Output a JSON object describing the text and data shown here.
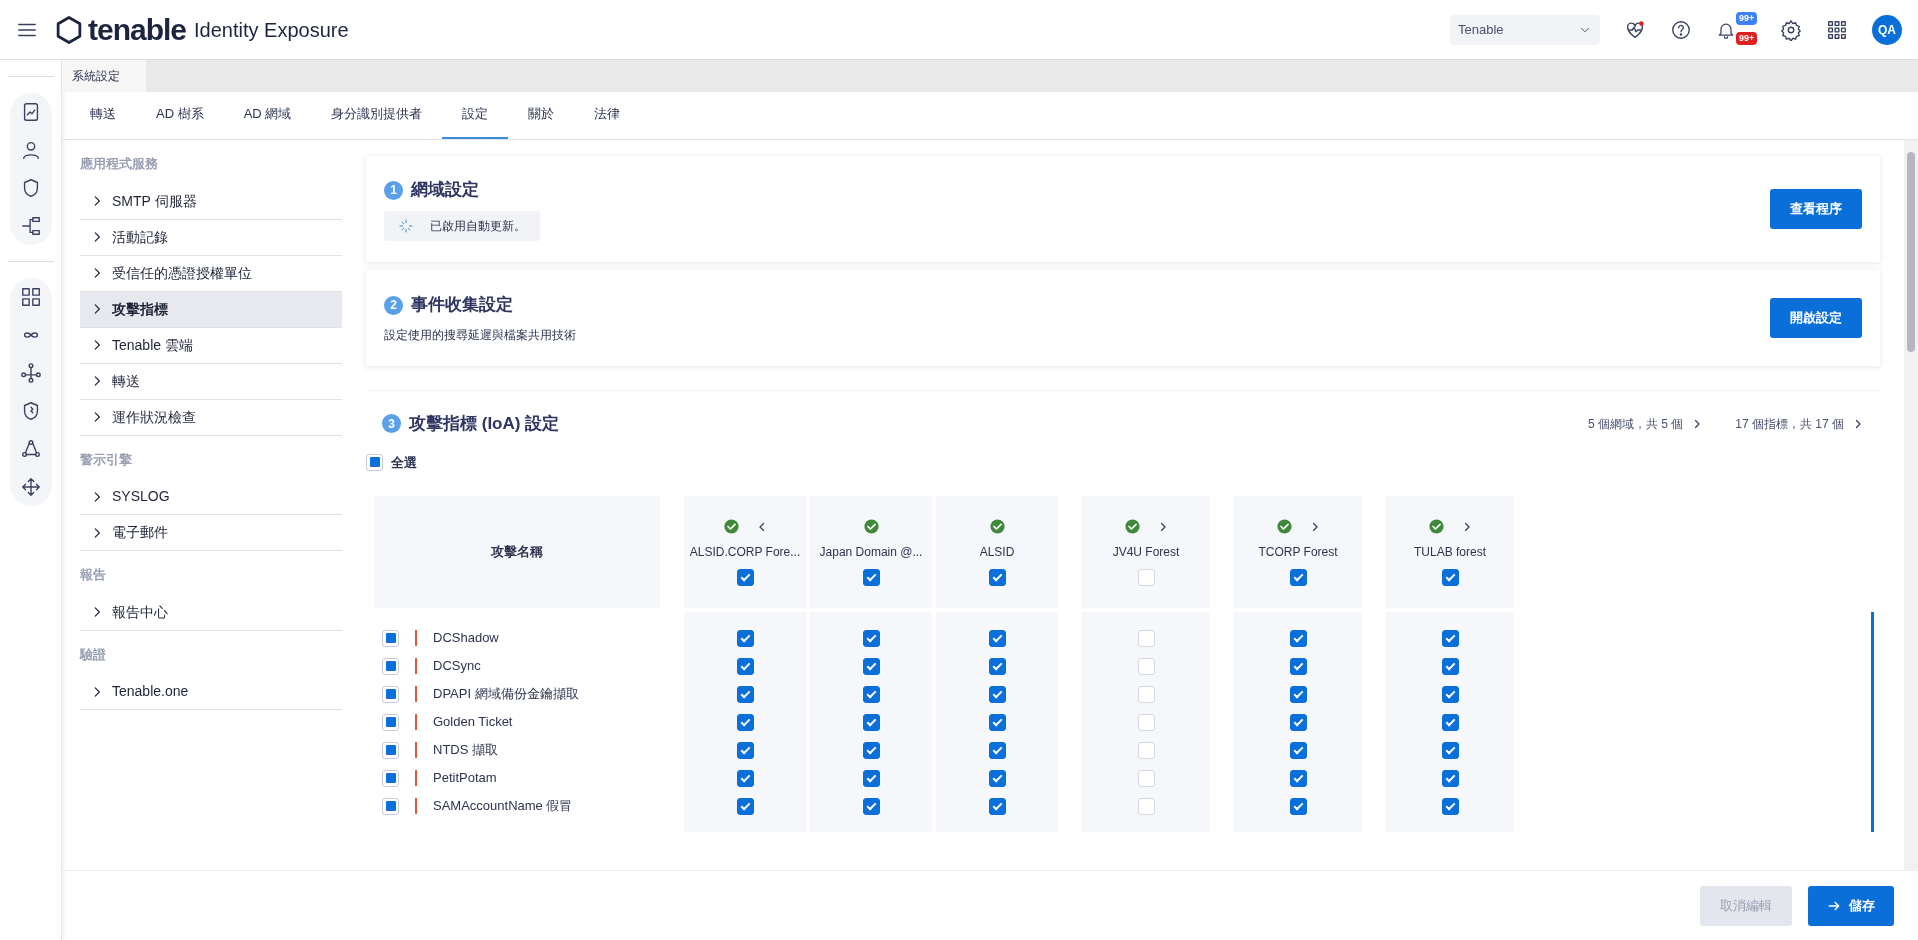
{
  "header": {
    "logo": "tenable",
    "product": "Identity Exposure",
    "tenant_select": {
      "value": "Tenable"
    },
    "notifications": [
      {
        "text": "99+",
        "color": "#3b82f6"
      },
      {
        "text": "99+",
        "color": "#e02020"
      }
    ],
    "avatar": "QA"
  },
  "page_tab": "系統設定",
  "tabs": [
    {
      "label": "轉送",
      "selected": false
    },
    {
      "label": "AD 樹系",
      "selected": false
    },
    {
      "label": "AD 網域",
      "selected": false
    },
    {
      "label": "身分識別提供者",
      "selected": false
    },
    {
      "label": "設定",
      "selected": true
    },
    {
      "label": "關於",
      "selected": false
    },
    {
      "label": "法律",
      "selected": false
    }
  ],
  "sidebar": [
    {
      "heading": "應用程式服務",
      "items": [
        {
          "label": "SMTP 伺服器",
          "selected": false
        },
        {
          "label": "活動記錄",
          "selected": false
        },
        {
          "label": "受信任的憑證授權單位",
          "selected": false
        },
        {
          "label": "攻擊指標",
          "selected": true
        },
        {
          "label": "Tenable 雲端",
          "selected": false
        },
        {
          "label": "轉送",
          "selected": false
        },
        {
          "label": "運作狀況檢查",
          "selected": false
        }
      ]
    },
    {
      "heading": "警示引擎",
      "items": [
        {
          "label": "SYSLOG",
          "selected": false
        },
        {
          "label": "電子郵件",
          "selected": false
        }
      ]
    },
    {
      "heading": "報告",
      "items": [
        {
          "label": "報告中心",
          "selected": false
        }
      ]
    },
    {
      "heading": "驗證",
      "items": [
        {
          "label": "Tenable.one",
          "selected": false
        }
      ]
    }
  ],
  "sections": [
    {
      "number": "1",
      "title": "網域設定",
      "status": "已啟用自動更新。",
      "button": "查看程序"
    },
    {
      "number": "2",
      "title": "事件收集設定",
      "description": "設定使用的搜尋延遲與檔案共用技術",
      "button": "開啟設定"
    }
  ],
  "ioa": {
    "number": "3",
    "title": "攻擊指標 (IoA) 設定",
    "domain_count": "5 個網域，共 5 個",
    "indicator_count": "17 個指標，共 17 個",
    "select_all": {
      "label": "全選",
      "checked": false,
      "indeterminate": true
    },
    "name_header": "攻擊名稱",
    "domains": [
      {
        "name": "ALSID.CORP Fore...",
        "prev": true,
        "checked": true
      },
      {
        "name": "Japan Domain @...",
        "checked": true
      },
      {
        "name": "ALSID",
        "checked": true
      },
      {
        "name": "JV4U Forest",
        "next": true,
        "checked": false
      },
      {
        "name": "TCORP Forest",
        "next": true,
        "checked": true
      },
      {
        "name": "TULAB forest",
        "next": true,
        "checked": true
      }
    ],
    "rows": [
      {
        "name": "DCShadow",
        "checked": false,
        "indeterminate": true,
        "checks": [
          true,
          true,
          true,
          false,
          true,
          true
        ]
      },
      {
        "name": "DCSync",
        "checked": false,
        "indeterminate": true,
        "checks": [
          true,
          true,
          true,
          false,
          true,
          true
        ]
      },
      {
        "name": "DPAPI 網域備份金鑰擷取",
        "checked": false,
        "indeterminate": true,
        "checks": [
          true,
          true,
          true,
          false,
          true,
          true
        ]
      },
      {
        "name": "Golden Ticket",
        "checked": false,
        "indeterminate": true,
        "checks": [
          true,
          true,
          true,
          false,
          true,
          true
        ]
      },
      {
        "name": "NTDS 擷取",
        "checked": false,
        "indeterminate": true,
        "checks": [
          true,
          true,
          true,
          false,
          true,
          true
        ]
      },
      {
        "name": "PetitPotam",
        "checked": false,
        "indeterminate": true,
        "checks": [
          true,
          true,
          true,
          false,
          true,
          true
        ]
      },
      {
        "name": "SAMAccountName 假冒",
        "checked": false,
        "indeterminate": true,
        "checks": [
          true,
          true,
          true,
          false,
          true,
          true
        ]
      }
    ]
  },
  "footer": {
    "cancel": {
      "label": "取消編輯",
      "disabled": true
    },
    "save": "儲存"
  }
}
